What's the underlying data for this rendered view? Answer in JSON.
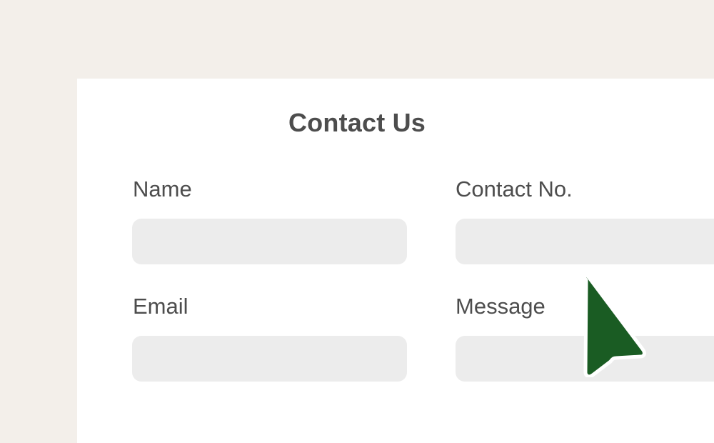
{
  "form": {
    "title": "Contact Us",
    "fields": {
      "name": {
        "label": "Name",
        "value": "",
        "placeholder": ""
      },
      "contact_no": {
        "label": "Contact No.",
        "value": "",
        "placeholder": ""
      },
      "email": {
        "label": "Email",
        "value": "",
        "placeholder": ""
      },
      "message": {
        "label": "Message",
        "value": "",
        "placeholder": ""
      }
    }
  },
  "cursor": {
    "icon": "mouse-pointer-icon",
    "color": "#1a5c23"
  },
  "colors": {
    "background": "#f3efea",
    "card": "#ffffff",
    "input_fill": "#ececec",
    "text": "#4d4d4d"
  }
}
